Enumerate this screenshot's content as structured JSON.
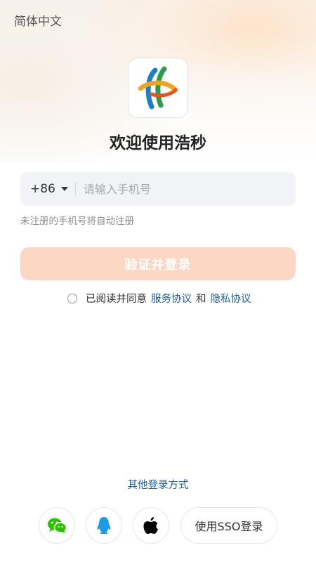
{
  "header": {
    "language": "简体中文"
  },
  "app": {
    "logo_icon": "app-logo-icon",
    "welcome": "欢迎使用浩秒"
  },
  "login": {
    "country_code": "+86",
    "phone_placeholder": "请输入手机号",
    "phone_value": "",
    "hint": "未注册的手机号将自动注册",
    "submit_label": "验证并登录",
    "agreement": {
      "prefix": "已阅读并同意",
      "service_link": "服务协议",
      "and": "和",
      "privacy_link": "隐私协议",
      "checked": false
    }
  },
  "other_login": {
    "title": "其他登录方式",
    "sso_label": "使用SSO登录",
    "icons": [
      "wechat-icon",
      "qq-icon",
      "apple-icon"
    ]
  },
  "colors": {
    "accent": "#FCD7C4",
    "link": "#1A5EA8",
    "input_bg": "#F2F3F6",
    "wechat": "#2DC100",
    "qq": "#1E9BE6"
  }
}
